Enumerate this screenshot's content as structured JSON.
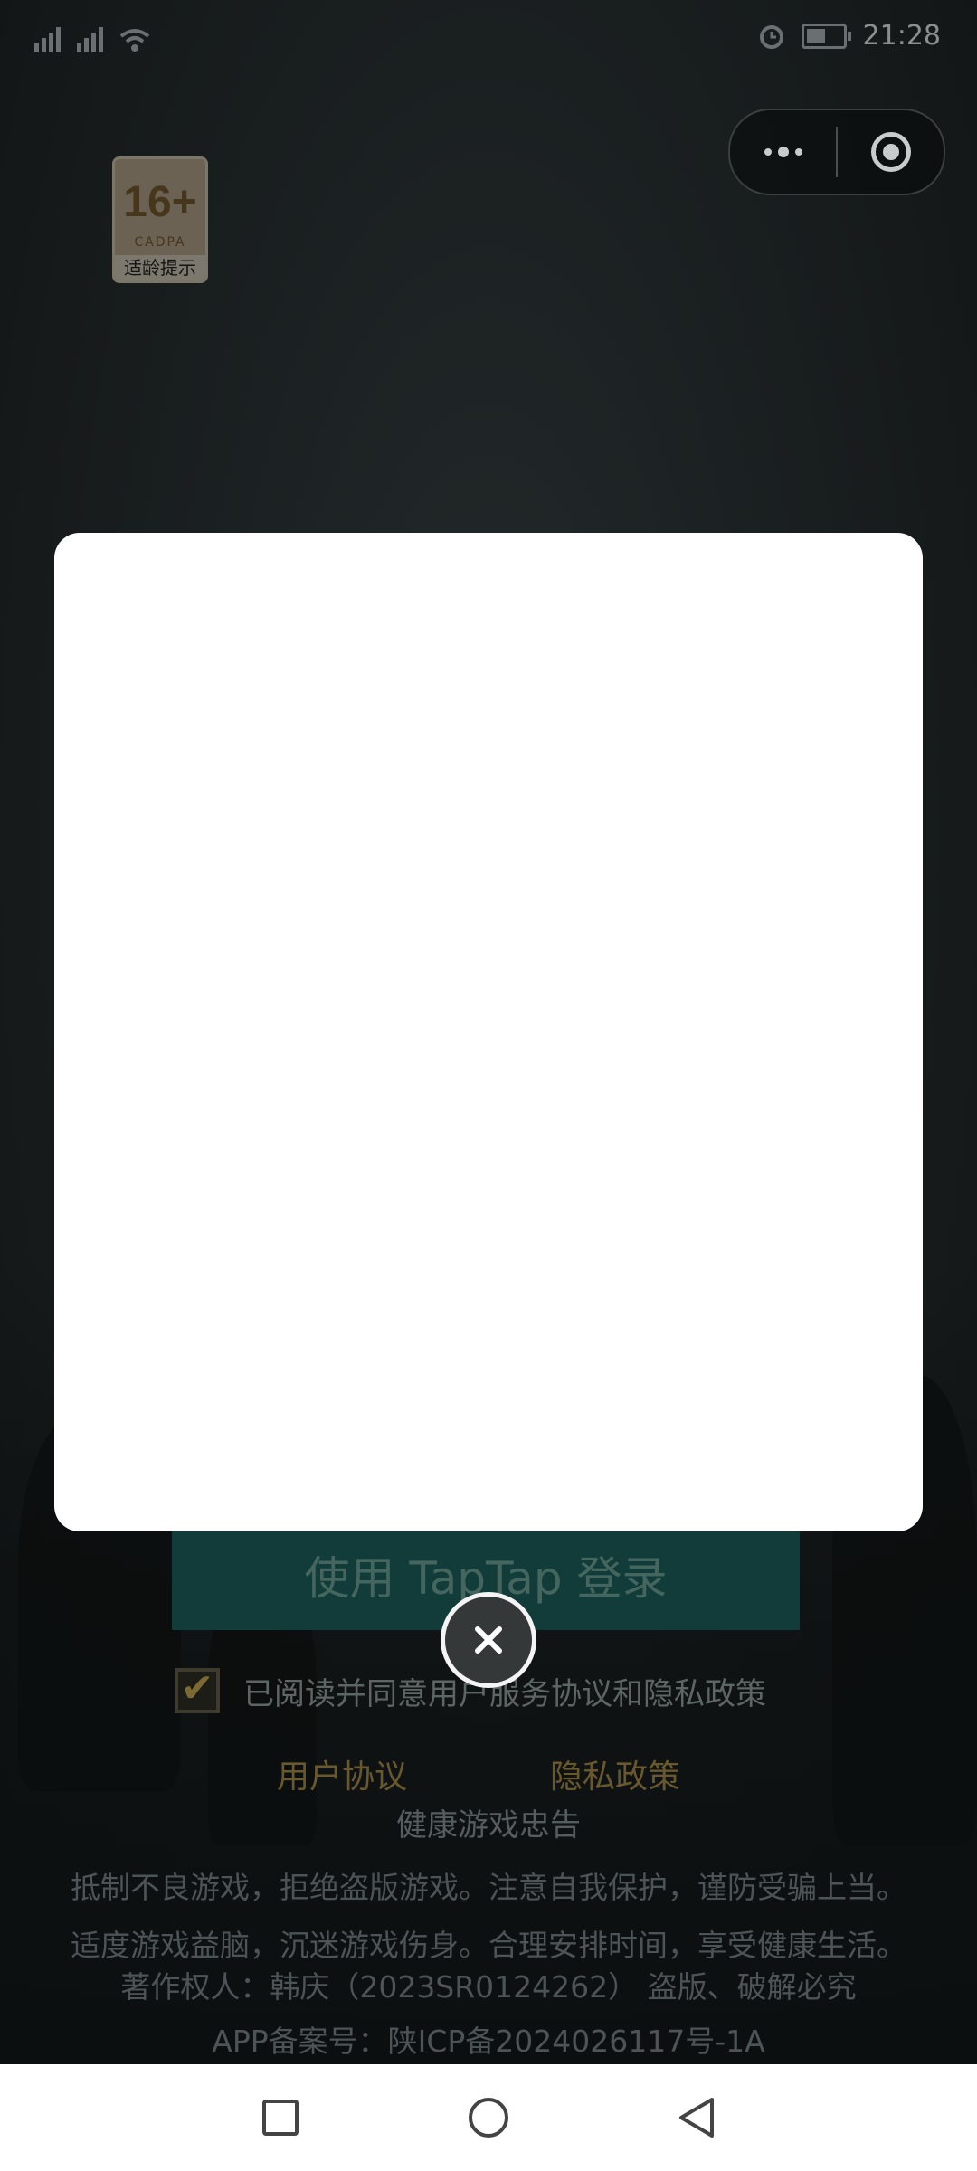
{
  "status_bar": {
    "time": "21:28"
  },
  "capsule": {
    "more_icon": "more-dots-icon",
    "close_icon": "exit-miniprogram-icon"
  },
  "age_badge": {
    "rating": "16+",
    "org": "CADPA",
    "tip": "适龄提示"
  },
  "login": {
    "button_label": "使用 TapTap 登录",
    "agree_text": "已阅读并同意用户服务协议和隐私政策",
    "agree_checked": true
  },
  "links": {
    "user_agreement": "用户协议",
    "privacy_policy": "隐私政策"
  },
  "footer": {
    "heading": "健康游戏忠告",
    "line1": "抵制不良游戏，拒绝盗版游戏。注意自我保护，谨防受骗上当。",
    "line2": "适度游戏益脑，沉迷游戏伤身。合理安排时间，享受健康生活。",
    "copyright": "著作权人：韩庆（2023SR0124262） 盗版、破解必究",
    "icp": "APP备案号：陕ICP备2024026117号-1A"
  },
  "modal": {
    "close_icon": "close-icon"
  },
  "nav_bar": {
    "recent_icon": "square-icon",
    "home_icon": "circle-icon",
    "back_icon": "triangle-back-icon"
  },
  "colors": {
    "accent_button": "#123c39",
    "link_gold": "#69582d",
    "modal_bg": "#ffffff"
  }
}
